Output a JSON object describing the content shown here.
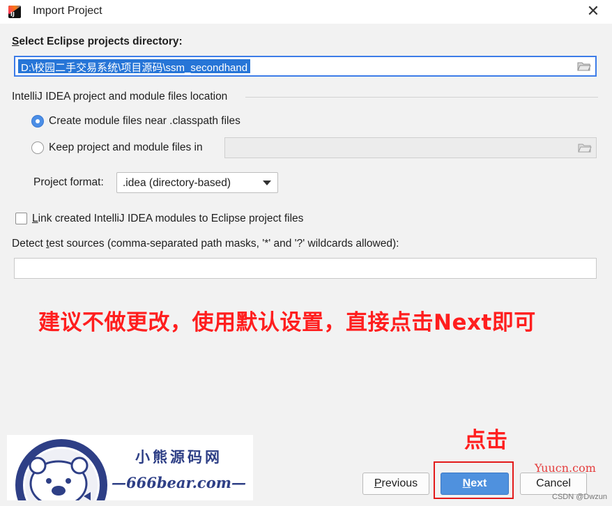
{
  "window": {
    "title": "Import Project",
    "close_glyph": "✕"
  },
  "eclipse_dir": {
    "label": "Select Eclipse projects directory:",
    "value": "D:\\校园二手交易系统\\项目源码\\ssm_secondhand"
  },
  "location_group": {
    "title": "IntelliJ IDEA project and module files location",
    "option_near_classpath": "Create module files near .classpath files",
    "option_keep_in": "Keep project and module files in",
    "selected": "option_near_classpath",
    "keep_in_path": ""
  },
  "project_format": {
    "label": "Project format:",
    "selected": ".idea (directory-based)"
  },
  "link_modules": {
    "label": "Link created IntelliJ IDEA modules to Eclipse project files",
    "checked": false
  },
  "test_sources": {
    "label": "Detect test sources (comma-separated path masks, '*' and '?' wildcards allowed):",
    "value": ""
  },
  "annotations": {
    "instruction": "建议不做更改，使用默认设置，直接点击Next即可",
    "click_hint": "点击"
  },
  "logo": {
    "title_cn": "小熊源码网",
    "domain": "—666bear.com—"
  },
  "buttons": {
    "previous": "Previous",
    "next": "Next",
    "cancel": "Cancel"
  },
  "watermarks": {
    "site": "Yuucn.com",
    "author": "CSDN @Dwzun"
  },
  "colors": {
    "accent": "#4f91de",
    "annotation_red": "#ff1e1e",
    "logo_blue": "#2e3f86"
  }
}
